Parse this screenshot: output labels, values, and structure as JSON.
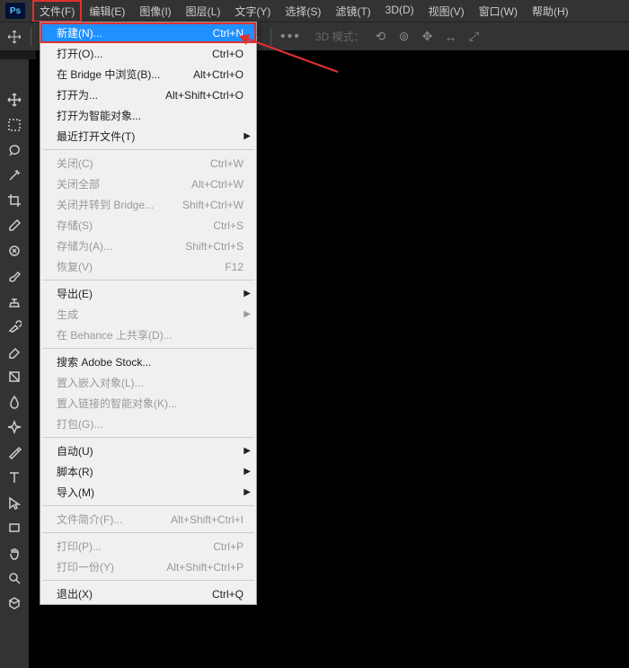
{
  "menubar": {
    "items": [
      "文件(F)",
      "编辑(E)",
      "图像(I)",
      "图层(L)",
      "文字(Y)",
      "选择(S)",
      "滤镜(T)",
      "3D(D)",
      "视图(V)",
      "窗口(W)",
      "帮助(H)"
    ],
    "active_index": 0
  },
  "optionbar": {
    "mode_3d_label": "3D 模式：",
    "dots": "•••"
  },
  "dropdown": {
    "groups": [
      [
        {
          "label": "新建(N)...",
          "shortcut": "Ctrl+N",
          "highlighted": true
        },
        {
          "label": "打开(O)...",
          "shortcut": "Ctrl+O"
        },
        {
          "label": "在 Bridge 中浏览(B)...",
          "shortcut": "Alt+Ctrl+O"
        },
        {
          "label": "打开为...",
          "shortcut": "Alt+Shift+Ctrl+O"
        },
        {
          "label": "打开为智能对象..."
        },
        {
          "label": "最近打开文件(T)",
          "submenu": true
        }
      ],
      [
        {
          "label": "关闭(C)",
          "shortcut": "Ctrl+W",
          "disabled": true
        },
        {
          "label": "关闭全部",
          "shortcut": "Alt+Ctrl+W",
          "disabled": true
        },
        {
          "label": "关闭并转到 Bridge...",
          "shortcut": "Shift+Ctrl+W",
          "disabled": true
        },
        {
          "label": "存储(S)",
          "shortcut": "Ctrl+S",
          "disabled": true
        },
        {
          "label": "存储为(A)...",
          "shortcut": "Shift+Ctrl+S",
          "disabled": true
        },
        {
          "label": "恢复(V)",
          "shortcut": "F12",
          "disabled": true
        }
      ],
      [
        {
          "label": "导出(E)",
          "submenu": true
        },
        {
          "label": "生成",
          "submenu": true,
          "disabled": true
        },
        {
          "label": "在 Behance 上共享(D)...",
          "disabled": true
        }
      ],
      [
        {
          "label": "搜索 Adobe Stock..."
        },
        {
          "label": "置入嵌入对象(L)...",
          "disabled": true
        },
        {
          "label": "置入链接的智能对象(K)...",
          "disabled": true
        },
        {
          "label": "打包(G)...",
          "disabled": true
        }
      ],
      [
        {
          "label": "自动(U)",
          "submenu": true
        },
        {
          "label": "脚本(R)",
          "submenu": true
        },
        {
          "label": "导入(M)",
          "submenu": true
        }
      ],
      [
        {
          "label": "文件简介(F)...",
          "shortcut": "Alt+Shift+Ctrl+I",
          "disabled": true
        }
      ],
      [
        {
          "label": "打印(P)...",
          "shortcut": "Ctrl+P",
          "disabled": true
        },
        {
          "label": "打印一份(Y)",
          "shortcut": "Alt+Shift+Ctrl+P",
          "disabled": true
        }
      ],
      [
        {
          "label": "退出(X)",
          "shortcut": "Ctrl+Q"
        }
      ]
    ]
  },
  "tools": [
    "move",
    "marquee",
    "lasso",
    "magic-wand",
    "crop",
    "eyedropper",
    "spot-heal",
    "brush",
    "clone-stamp",
    "history-brush",
    "eraser",
    "gradient",
    "blur",
    "dodge",
    "pen",
    "type",
    "path-select",
    "rectangle",
    "hand",
    "zoom",
    "artboard"
  ]
}
